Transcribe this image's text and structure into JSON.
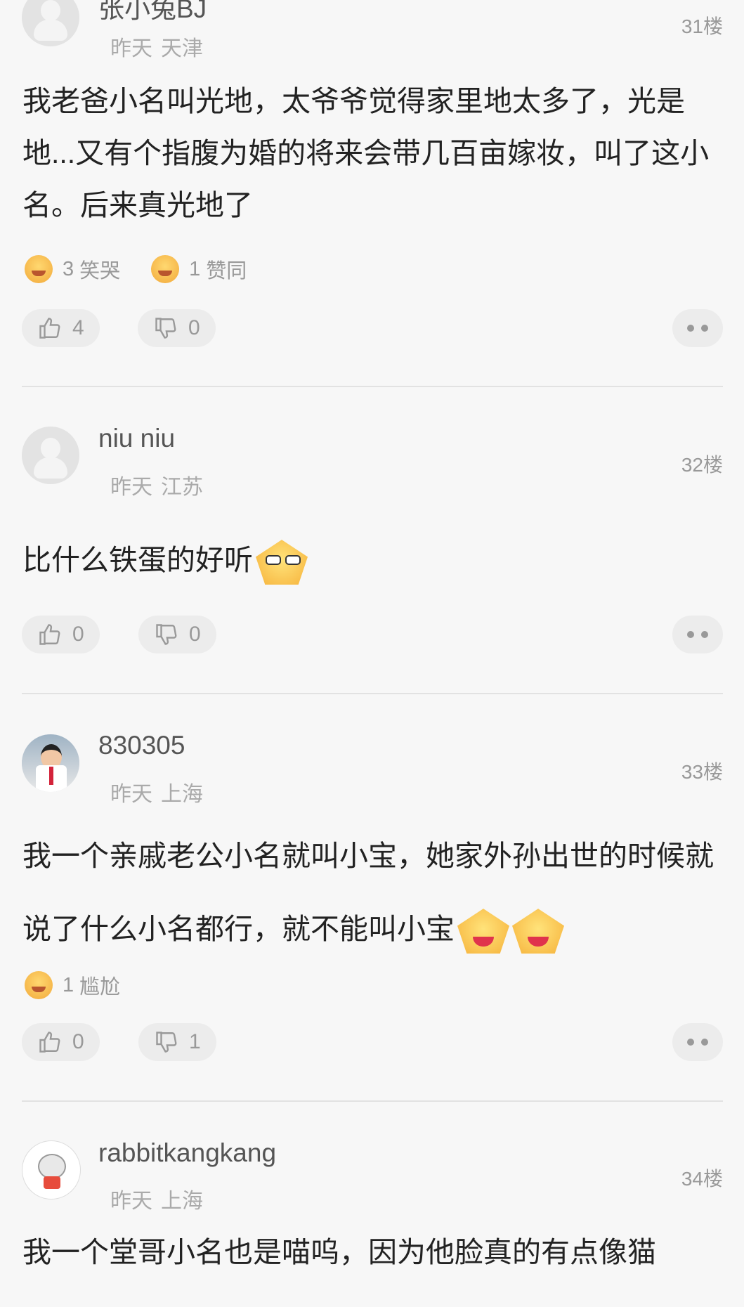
{
  "comments": [
    {
      "username": "张小兔BJ",
      "time": "昨天",
      "location": "天津",
      "floor": "31楼",
      "text": "我老爸小名叫光地，太爷爷觉得家里地太多了，光是地...又有个指腹为婚的将来会带几百亩嫁妆，叫了这小名。后来真光地了",
      "reactions": [
        {
          "icon": "laugh-cry-emoji",
          "count": "3",
          "label": "笑哭"
        },
        {
          "icon": "heart-face-emoji",
          "count": "1",
          "label": "赞同"
        }
      ],
      "likes": "4",
      "dislikes": "0"
    },
    {
      "username": "niu niu",
      "time": "昨天",
      "location": "江苏",
      "floor": "32楼",
      "text": "比什么铁蛋的好听",
      "likes": "0",
      "dislikes": "0"
    },
    {
      "username": "830305",
      "time": "昨天",
      "location": "上海",
      "floor": "33楼",
      "text": "我一个亲戚老公小名就叫小宝，她家外孙出世的时候就说了什么小名都行，就不能叫小宝",
      "reactions": [
        {
          "icon": "awkward-emoji",
          "count": "1",
          "label": "尴尬"
        }
      ],
      "likes": "0",
      "dislikes": "1"
    },
    {
      "username": "rabbitkangkang",
      "time": "昨天",
      "location": "上海",
      "floor": "34楼",
      "text": "我一个堂哥小名也是喵呜，因为他脸真的有点像猫"
    }
  ]
}
